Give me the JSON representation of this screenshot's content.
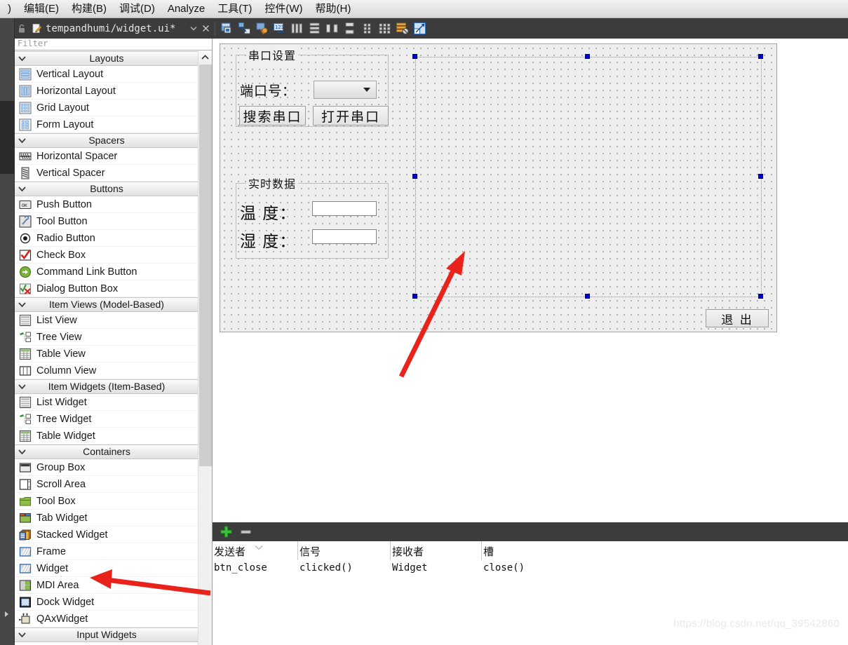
{
  "menubar": {
    "items": [
      {
        "label": ")"
      },
      {
        "label": "编辑(E)"
      },
      {
        "label": "构建(B)"
      },
      {
        "label": "调试(D)"
      },
      {
        "label": "Analyze"
      },
      {
        "label": "工具(T)"
      },
      {
        "label": "控件(W)"
      },
      {
        "label": "帮助(H)"
      }
    ]
  },
  "docbar": {
    "filename": "tempandhumi/widget.ui*",
    "lock_icon": "lock-icon",
    "edit_icon": "pencil-icon",
    "dropdown_icon": "chevron-down-icon",
    "close_icon": "close-icon",
    "tools": [
      {
        "name": "edit-widgets-icon",
        "title": "Edit Widgets"
      },
      {
        "name": "edit-signals-slots-icon",
        "title": "Edit Signals/Slots"
      },
      {
        "name": "edit-buddies-icon",
        "title": "Edit Buddies"
      },
      {
        "name": "edit-tab-order-icon",
        "title": "Edit Tab Order"
      },
      {
        "name": "layout-horizontally-icon",
        "title": "Lay Out Horizontally"
      },
      {
        "name": "layout-vertically-icon",
        "title": "Lay Out Vertically"
      },
      {
        "name": "layout-splitter-horizontal-icon",
        "title": "Lay Out Horizontally in Splitter"
      },
      {
        "name": "layout-splitter-vertical-icon",
        "title": "Lay Out Vertically in Splitter"
      },
      {
        "name": "layout-form-icon",
        "title": "Lay Out in a Form Layout"
      },
      {
        "name": "layout-grid-icon",
        "title": "Lay Out in a Grid"
      },
      {
        "name": "break-layout-icon",
        "title": "Break Layout"
      },
      {
        "name": "adjust-size-icon",
        "title": "Adjust Size"
      }
    ]
  },
  "widgetbox": {
    "filter_placeholder": "Filter",
    "groups": [
      {
        "title": "Layouts",
        "items": [
          {
            "label": "Vertical Layout",
            "icon": "vertical-layout-icon"
          },
          {
            "label": "Horizontal Layout",
            "icon": "horizontal-layout-icon"
          },
          {
            "label": "Grid Layout",
            "icon": "grid-layout-icon"
          },
          {
            "label": "Form Layout",
            "icon": "form-layout-icon"
          }
        ]
      },
      {
        "title": "Spacers",
        "items": [
          {
            "label": "Horizontal Spacer",
            "icon": "horizontal-spacer-icon"
          },
          {
            "label": "Vertical Spacer",
            "icon": "vertical-spacer-icon"
          }
        ]
      },
      {
        "title": "Buttons",
        "items": [
          {
            "label": "Push Button",
            "icon": "push-button-icon"
          },
          {
            "label": "Tool Button",
            "icon": "tool-button-icon"
          },
          {
            "label": "Radio Button",
            "icon": "radio-button-icon"
          },
          {
            "label": "Check Box",
            "icon": "check-box-icon"
          },
          {
            "label": "Command Link Button",
            "icon": "command-link-button-icon"
          },
          {
            "label": "Dialog Button Box",
            "icon": "dialog-button-box-icon"
          }
        ]
      },
      {
        "title": "Item Views (Model-Based)",
        "items": [
          {
            "label": "List View",
            "icon": "list-view-icon"
          },
          {
            "label": "Tree View",
            "icon": "tree-view-icon"
          },
          {
            "label": "Table View",
            "icon": "table-view-icon"
          },
          {
            "label": "Column View",
            "icon": "column-view-icon"
          }
        ]
      },
      {
        "title": "Item Widgets (Item-Based)",
        "items": [
          {
            "label": "List Widget",
            "icon": "list-widget-icon"
          },
          {
            "label": "Tree Widget",
            "icon": "tree-widget-icon"
          },
          {
            "label": "Table Widget",
            "icon": "table-widget-icon"
          }
        ]
      },
      {
        "title": "Containers",
        "items": [
          {
            "label": "Group Box",
            "icon": "group-box-icon"
          },
          {
            "label": "Scroll Area",
            "icon": "scroll-area-icon"
          },
          {
            "label": "Tool Box",
            "icon": "tool-box-icon"
          },
          {
            "label": "Tab Widget",
            "icon": "tab-widget-icon"
          },
          {
            "label": "Stacked Widget",
            "icon": "stacked-widget-icon"
          },
          {
            "label": "Frame",
            "icon": "frame-icon"
          },
          {
            "label": "Widget",
            "icon": "widget-icon"
          },
          {
            "label": "MDI Area",
            "icon": "mdi-area-icon"
          },
          {
            "label": "Dock Widget",
            "icon": "dock-widget-icon"
          },
          {
            "label": "QAxWidget",
            "icon": "qax-widget-icon"
          }
        ]
      },
      {
        "title": "Input Widgets",
        "items": []
      }
    ]
  },
  "form": {
    "serial_group": {
      "title": "串口设置",
      "port_label": "端口号：",
      "port_value": "",
      "search_button": "搜索串口",
      "open_button": "打开串口"
    },
    "data_group": {
      "title": "实时数据",
      "temp_label": "温 度：",
      "temp_value": "",
      "humi_label": "湿 度：",
      "humi_value": ""
    },
    "exit_button": "退 出"
  },
  "signal_slot_editor": {
    "add_icon": "plus-icon",
    "remove_icon": "minus-icon",
    "columns": [
      "发送者",
      "信号",
      "接收者",
      "槽"
    ],
    "rows": [
      {
        "sender": "btn_close",
        "signal": "clicked()",
        "receiver": "Widget",
        "slot": "close()"
      }
    ]
  },
  "watermark": "https://blog.csdn.net/qq_39542860",
  "colors": {
    "menubar_bg": "#e4e4e4",
    "toolbar_bg": "#3c3c3c",
    "rail_bg": "#474747",
    "rail_active": "#2b2b2b",
    "canvas_bg": "#efefef",
    "selection_handle": "#0000c8",
    "annotation_arrow": "#e8231c",
    "add_icon_green": "#32b332"
  }
}
